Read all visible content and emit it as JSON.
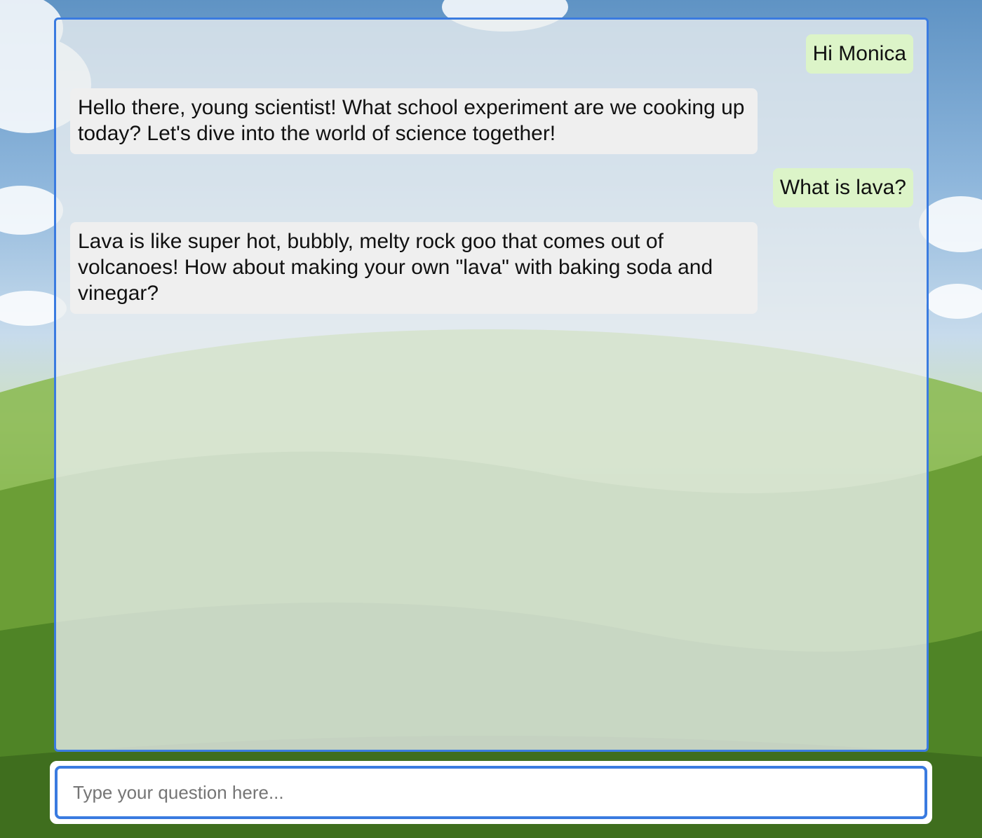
{
  "chat": {
    "messages": [
      {
        "role": "user",
        "text": "Hi Monica"
      },
      {
        "role": "assistant",
        "text": "Hello there, young scientist! What school experiment are we cooking up today? Let's dive into the world of science together!"
      },
      {
        "role": "user",
        "text": "What is lava?"
      },
      {
        "role": "assistant",
        "text": "Lava is like super hot, bubbly, melty rock goo that comes out of volcanoes! How about making your own \"lava\" with baking soda and vinegar?"
      }
    ]
  },
  "input": {
    "placeholder": "Type your question here...",
    "value": ""
  },
  "colors": {
    "accent": "#3a7be0",
    "user_bubble": "#dcf4c8",
    "assistant_bubble": "#efefef"
  },
  "background": {
    "icon": "landscape-image"
  }
}
